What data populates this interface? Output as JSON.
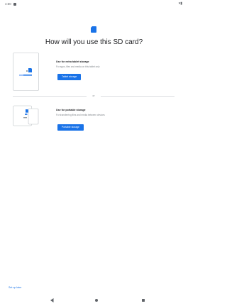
{
  "status_bar": {
    "time": "4:50",
    "right_icons": "▾▮"
  },
  "icons": {
    "sd_card": "sd-card-icon",
    "tablet_storage": "tablet-storage-illustration",
    "portable_storage": "portable-storage-illustration",
    "back": "back-icon",
    "home": "home-icon",
    "recents": "recents-icon"
  },
  "page": {
    "title": "How will you use this SD card?"
  },
  "options": {
    "internal": {
      "title": "Use for extra tablet storage",
      "description": "For apps, files and media on this tablet only",
      "button": "Tablet storage"
    },
    "portable": {
      "title": "Use for portable storage",
      "description": "For transferring files and media between devices",
      "button": "Portable storage"
    }
  },
  "divider_label": "or",
  "footer": {
    "setup_later": "Set up later"
  },
  "colors": {
    "accent": "#1a73e8",
    "text": "#202124",
    "secondary_text": "#80868b",
    "divider": "#dadce0"
  }
}
